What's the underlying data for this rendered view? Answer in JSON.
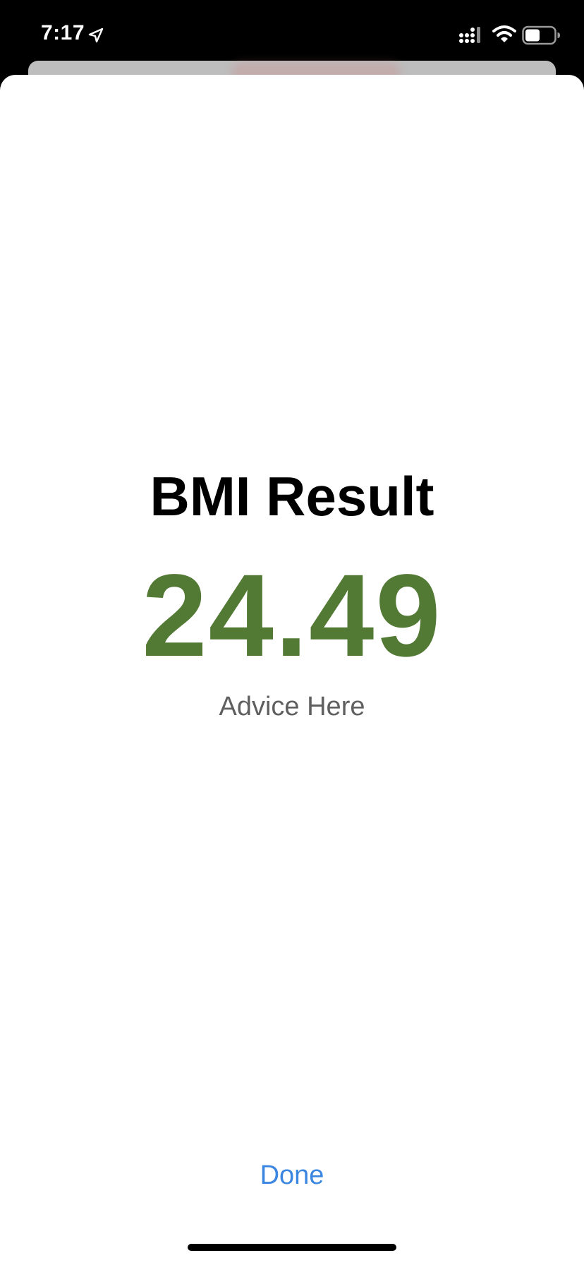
{
  "status_bar": {
    "time": "7:17",
    "icons": [
      "location-arrow-icon",
      "signal-icon",
      "wifi-icon",
      "battery-icon"
    ]
  },
  "sheet": {
    "title": "BMI Result",
    "value": "24.49",
    "advice": "Advice Here",
    "done_label": "Done"
  },
  "colors": {
    "value": "#527a34",
    "done": "#3b86e0",
    "advice": "#5f5f5f",
    "background": "#ffffff",
    "status_bar": "#000000"
  }
}
